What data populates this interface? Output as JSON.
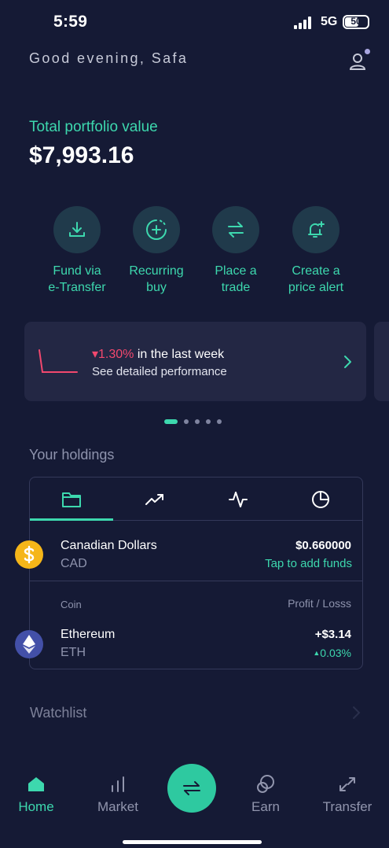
{
  "status_bar": {
    "time": "5:59",
    "network": "5G",
    "battery": "50"
  },
  "header": {
    "greeting": "Good evening, Safa"
  },
  "portfolio": {
    "label": "Total portfolio value",
    "value": "$7,993.16"
  },
  "actions": [
    {
      "line1": "Fund via",
      "line2": "e-Transfer",
      "icon": "download-icon"
    },
    {
      "line1": "Recurring",
      "line2": "buy",
      "icon": "recurring-plus-icon"
    },
    {
      "line1": "Place a",
      "line2": "trade",
      "icon": "swap-arrows-icon"
    },
    {
      "line1": "Create a",
      "line2": "price alert",
      "icon": "bell-plus-icon"
    }
  ],
  "performance": {
    "change": "1.30%",
    "period": " in the last week",
    "link": "See detailed performance",
    "color": "#f2486e"
  },
  "holdings": {
    "title": "Your holdings",
    "tabs": [
      "folder-icon",
      "trend-up-icon",
      "pulse-icon",
      "pie-chart-icon"
    ],
    "cash": {
      "name": "Canadian Dollars",
      "symbol": "CAD",
      "amount": "$0.660000",
      "action": "Tap to add funds"
    },
    "header_coin": "Coin",
    "header_pl": "Profit / Losss",
    "coins": [
      {
        "name": "Ethereum",
        "symbol": "ETH",
        "profit": "+$3.14",
        "pct": "0.03%"
      }
    ]
  },
  "watchlist": {
    "title": "Watchlist"
  },
  "nav": {
    "home": "Home",
    "market": "Market",
    "earn": "Earn",
    "transfer": "Transfer"
  },
  "colors": {
    "accent": "#3dd8ae",
    "background": "#151a35",
    "card": "#232744",
    "negative": "#f2486e"
  }
}
